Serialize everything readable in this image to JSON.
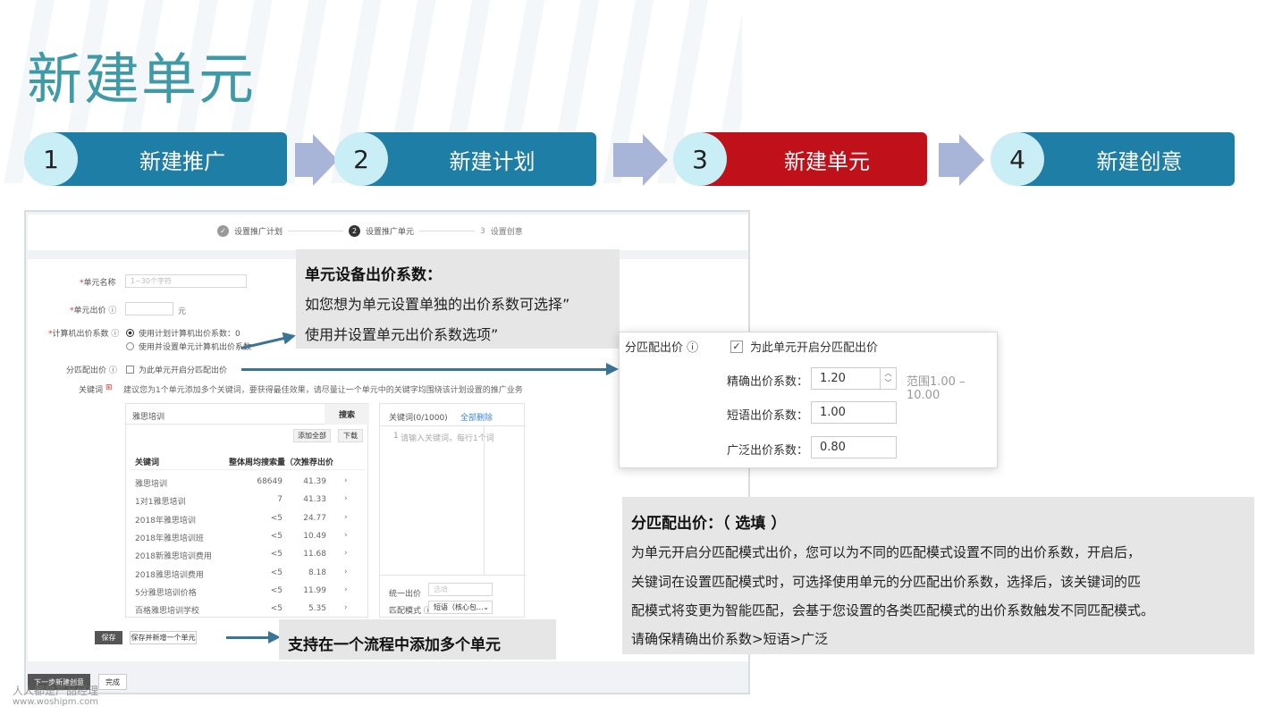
{
  "page_title": "新建单元",
  "steps": [
    {
      "num": "1",
      "label": "新建推广",
      "color": "#1e7ea6"
    },
    {
      "num": "2",
      "label": "新建计划",
      "color": "#1e7ea6"
    },
    {
      "num": "3",
      "label": "新建单元",
      "color": "#c0111b"
    },
    {
      "num": "4",
      "label": "新建创意",
      "color": "#1e7ea6"
    }
  ],
  "wizard": {
    "step1": "设置推广计划",
    "step2_num": "2",
    "step2": "设置推广单元",
    "step3_num": "3",
    "step3": "设置创意"
  },
  "form": {
    "unit_name_label": "单元名称",
    "unit_name_placeholder": "1~30个字符",
    "unit_bid_label": "单元出价 ⓘ",
    "unit_bid_unit": "元",
    "pc_coef_label": "计算机出价系数 ⓘ",
    "pc_opt1": "使用计划计算机出价系数：0",
    "pc_opt2": "使用并设置单元计算机出价系数",
    "match_label": "分匹配出价 ⓘ",
    "match_check": "为此单元开启分匹配出价",
    "keyword_label": "关键词",
    "keyword_hint": "建议您为1个单元添加多个关键词，要获得最佳效果，请尽量让一个单元中的关键字均围绕该计划设置的推广业务"
  },
  "keyword_table": {
    "search_value": "雅思培训",
    "search_btn": "搜索",
    "add_all": "添加全部",
    "download": "下载",
    "headers": [
      "关键词",
      "整体周均搜索量（次）",
      "推荐出价"
    ],
    "rows": [
      [
        "雅思培训",
        "68649",
        "41.39"
      ],
      [
        "1对1雅思培训",
        "7",
        "41.33"
      ],
      [
        "2018年雅思培训",
        "<5",
        "24.77"
      ],
      [
        "2018年雅思培训班",
        "<5",
        "10.49"
      ],
      [
        "2018新雅思培训费用",
        "<5",
        "11.68"
      ],
      [
        "2018雅思培训费用",
        "<5",
        "8.18"
      ],
      [
        "5分雅思培训价格",
        "<5",
        "11.99"
      ],
      [
        "百格雅思培训学校",
        "<5",
        "5.35"
      ]
    ],
    "row_arrow": "›"
  },
  "keyword_box": {
    "title": "关键词(0/1000)",
    "clear_all": "全部删除",
    "line_num": "1",
    "placeholder": "请输入关键词，每行1个词",
    "unified_bid_label": "统一出价",
    "unified_bid_placeholder": "选填",
    "match_mode_label": "匹配模式 ⓘ",
    "match_mode_value": "短语（核心包..."
  },
  "buttons": {
    "save": "保存",
    "save_add": "保存并新增一个单元",
    "next": "下一步新建创意",
    "done": "完成"
  },
  "callout1": {
    "title": "单元设备出价系数：",
    "line1": "如您想为单元设置单独的出价系数可选择”",
    "line2": "使用并设置单元出价系数选项”"
  },
  "bid_panel": {
    "label": "分匹配出价 ⓘ",
    "check_label": "为此单元开启分匹配出价",
    "exact_label": "精确出价系数：",
    "exact_value": "1.20",
    "range": "范围1.00 – 10.00",
    "phrase_label": "短语出价系数：",
    "phrase_value": "1.00",
    "broad_label": "广泛出价系数：",
    "broad_value": "0.80"
  },
  "callout2": {
    "title": "分匹配出价：（ 选填 ）",
    "line1": "为单元开启分匹配模式出价，您可以为不同的匹配模式设置不同的出价系数，开启后，",
    "line2": "关键词在设置匹配模式时，可选择使用单元的分匹配出价系数，选择后，该关键词的匹",
    "line3": "配模式将变更为智能匹配，会基于您设置的各类匹配模式的出价系数触发不同匹配模式。",
    "line4": "请确保精确出价系数>短语>广泛"
  },
  "callout3": {
    "text": "支持在一个流程中添加多个单元"
  },
  "watermark": {
    "line1": "人人都是产品经理",
    "line2": "www.woshipm.com"
  }
}
